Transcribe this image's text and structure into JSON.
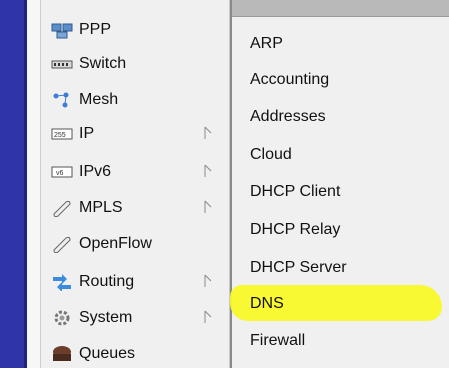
{
  "main_menu": [
    {
      "label": "PPP",
      "icon": "ppp-icon",
      "has_arrow": false
    },
    {
      "label": "Switch",
      "icon": "switch-icon",
      "has_arrow": false
    },
    {
      "label": "Mesh",
      "icon": "mesh-icon",
      "has_arrow": false
    },
    {
      "label": "IP",
      "icon": "ip-icon",
      "has_arrow": true
    },
    {
      "label": "IPv6",
      "icon": "ipv6-icon",
      "has_arrow": true
    },
    {
      "label": "MPLS",
      "icon": "mpls-icon",
      "has_arrow": true
    },
    {
      "label": "OpenFlow",
      "icon": "openflow-icon",
      "has_arrow": false
    },
    {
      "label": "Routing",
      "icon": "routing-icon",
      "has_arrow": true
    },
    {
      "label": "System",
      "icon": "system-icon",
      "has_arrow": true
    },
    {
      "label": "Queues",
      "icon": "queues-icon",
      "has_arrow": false
    }
  ],
  "ip_submenu": [
    {
      "label": "ARP"
    },
    {
      "label": "Accounting"
    },
    {
      "label": "Addresses"
    },
    {
      "label": "Cloud"
    },
    {
      "label": "DHCP Client"
    },
    {
      "label": "DHCP Relay"
    },
    {
      "label": "DHCP Server"
    },
    {
      "label": "DNS"
    },
    {
      "label": "Firewall"
    }
  ],
  "highlight_color": "#f8f828"
}
